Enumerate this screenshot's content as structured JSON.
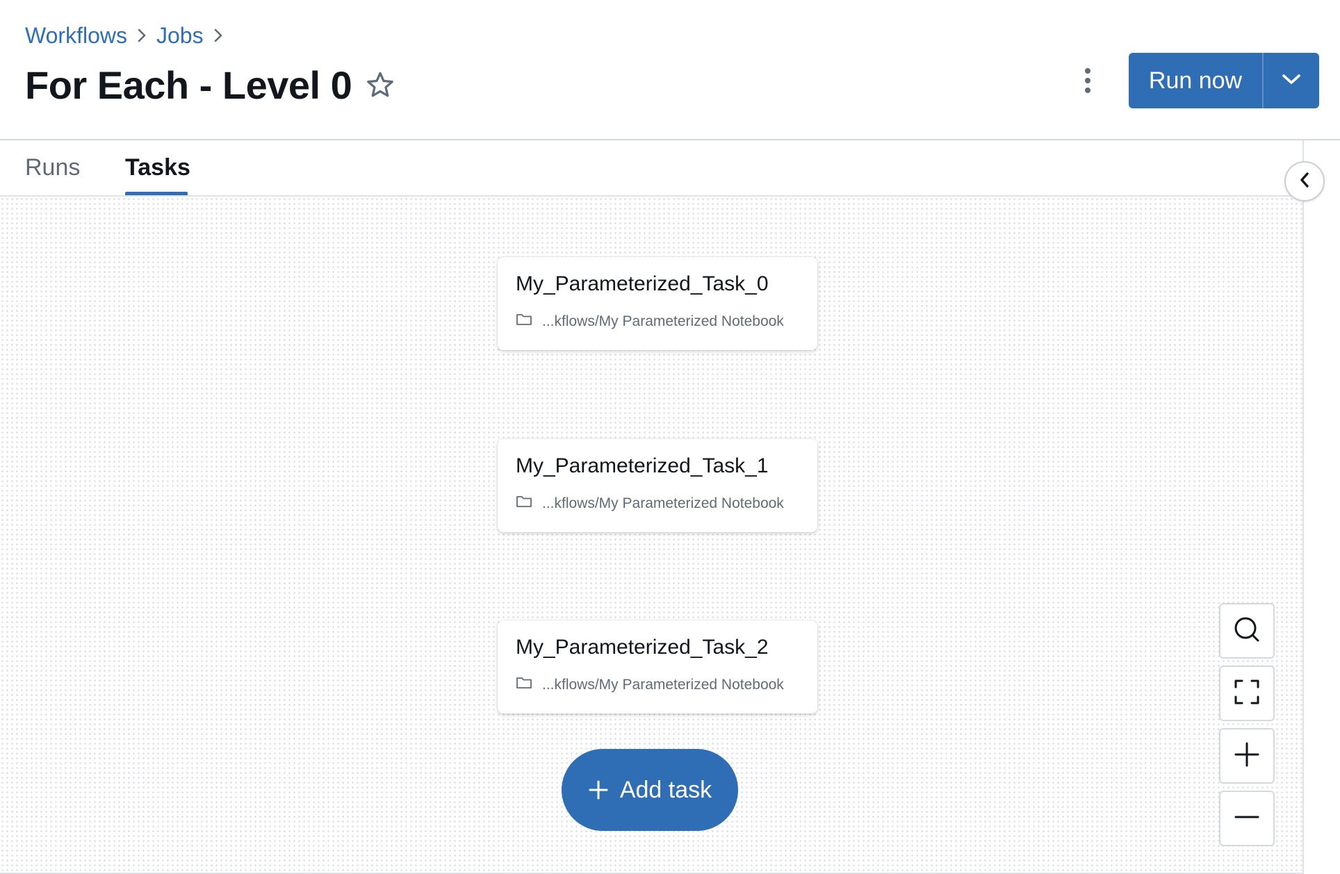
{
  "breadcrumb": {
    "items": [
      "Workflows",
      "Jobs"
    ]
  },
  "header": {
    "title": "For Each - Level 0",
    "run_now_label": "Run now"
  },
  "tabs": [
    {
      "label": "Runs",
      "active": false
    },
    {
      "label": "Tasks",
      "active": true
    }
  ],
  "tasks": [
    {
      "name": "My_Parameterized_Task_0",
      "path": "...kflows/My Parameterized Notebook"
    },
    {
      "name": "My_Parameterized_Task_1",
      "path": "...kflows/My Parameterized Notebook"
    },
    {
      "name": "My_Parameterized_Task_2",
      "path": "...kflows/My Parameterized Notebook"
    }
  ],
  "add_task_label": "Add task",
  "icons": {
    "breadcrumb_separator": "chevron-right-icon",
    "favorite": "star-icon",
    "more": "kebab-menu-icon",
    "run_dropdown": "chevron-down-icon",
    "collapse_panel": "chevron-left-icon",
    "task_type": "folder-icon",
    "zoom_controls": [
      "search-icon",
      "fit-to-screen-icon",
      "zoom-in-icon",
      "zoom-out-icon"
    ]
  },
  "colors": {
    "accent": "#2f6eb5",
    "link": "#2f6eb5",
    "text_primary": "#11171c",
    "text_secondary": "#5f6b77"
  }
}
